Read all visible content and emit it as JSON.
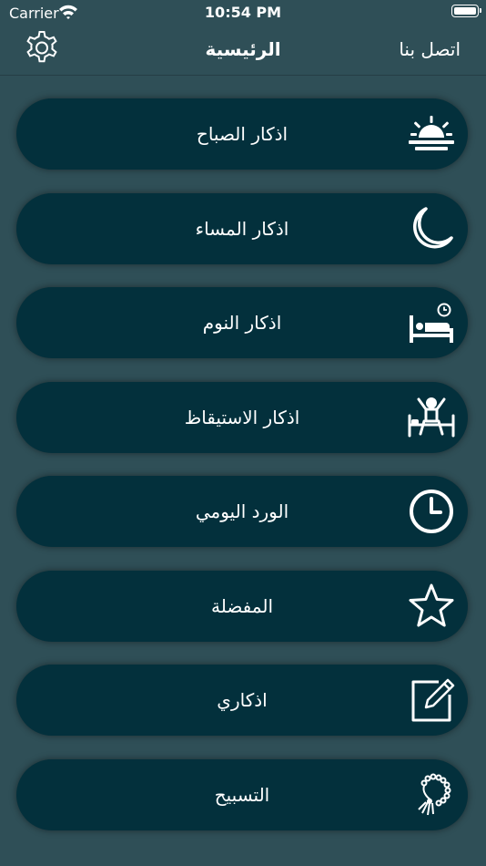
{
  "status_bar": {
    "carrier": "Carrier",
    "time": "10:54 PM"
  },
  "nav": {
    "title": "الرئيسية",
    "contact": "اتصل بنا",
    "settings_icon": "gear-icon"
  },
  "menu": [
    {
      "label": "اذكار الصباح",
      "icon": "sunrise-icon"
    },
    {
      "label": "اذكار المساء",
      "icon": "moon-icon"
    },
    {
      "label": "اذكار النوم",
      "icon": "bed-icon"
    },
    {
      "label": "اذكار الاستيقاظ",
      "icon": "wake-up-icon"
    },
    {
      "label": "الورد اليومي",
      "icon": "clock-icon"
    },
    {
      "label": "المفضلة",
      "icon": "star-icon"
    },
    {
      "label": "اذكاري",
      "icon": "edit-note-icon"
    },
    {
      "label": "التسبيح",
      "icon": "prayer-beads-icon"
    }
  ],
  "colors": {
    "background": "#2f4f57",
    "button": "#03303c",
    "text": "#ffffff"
  }
}
